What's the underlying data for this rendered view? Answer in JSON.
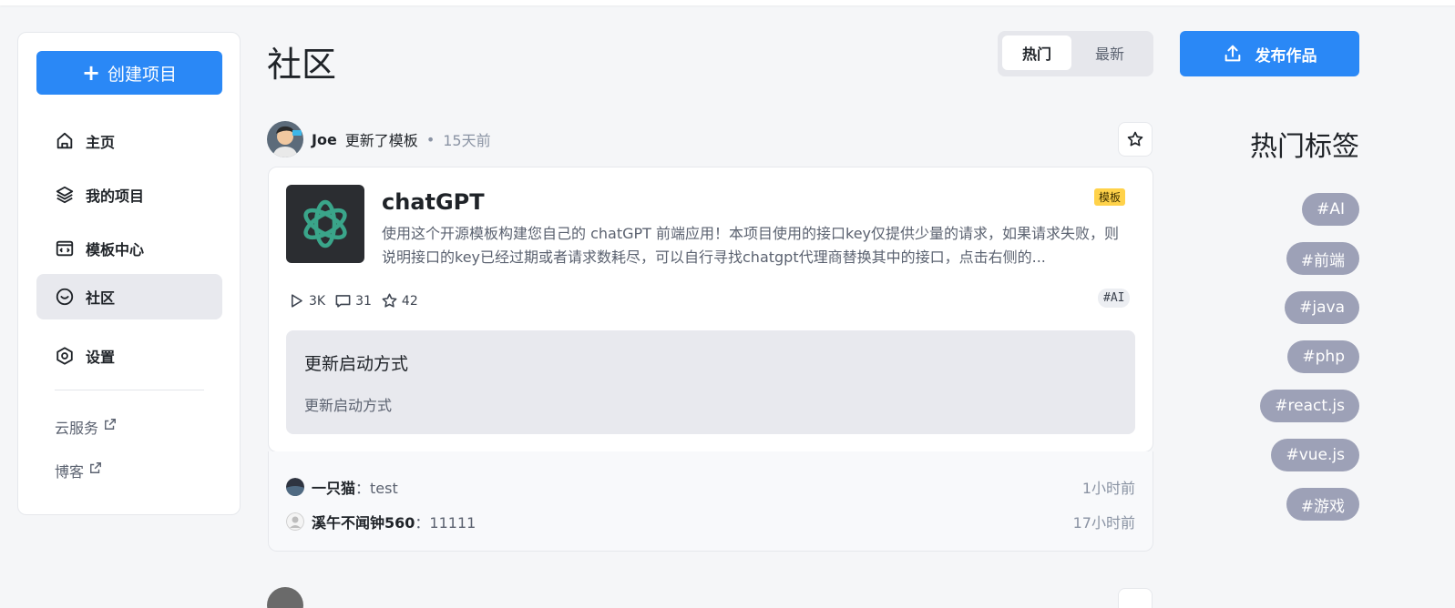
{
  "sidebar": {
    "create_label": "创建项目",
    "nav": [
      {
        "label": "主页"
      },
      {
        "label": "我的项目"
      },
      {
        "label": "模板中心"
      },
      {
        "label": "社区"
      },
      {
        "label": "设置"
      }
    ],
    "links": [
      {
        "label": "云服务"
      },
      {
        "label": "博客"
      }
    ]
  },
  "header": {
    "title": "社区",
    "tabs": [
      "热门",
      "最新"
    ],
    "active_tab": "热门",
    "publish_label": "发布作品"
  },
  "post": {
    "author": "Joe",
    "action": "更新了模板",
    "separator": "•",
    "time": "15天前",
    "project": {
      "title": "chatGPT",
      "badge": "模板",
      "description": "使用这个开源模板构建您自己的 chatGPT 前端应用！本项目使用的接口key仅提供少量的请求，如果请求失败，则说明接口的key已经过期或者请求数耗尽，可以自行寻找chatgpt代理商替换其中的接口，点击右侧的...",
      "plays": "3K",
      "comments": "31",
      "stars": "42",
      "tag": "#AI"
    },
    "update": {
      "title": "更新启动方式",
      "body": "更新启动方式"
    },
    "comment_list": [
      {
        "name": "一只猫",
        "sep": "：",
        "text": "test",
        "time": "1小时前"
      },
      {
        "name": "溪午不闻钟560",
        "sep": "：",
        "text": "11111",
        "time": "17小时前"
      }
    ]
  },
  "hot_tags": {
    "title": "热门标签",
    "items": [
      "#AI",
      "#前端",
      "#java",
      "#php",
      "#react.js",
      "#vue.js",
      "#游戏"
    ]
  },
  "colors": {
    "accent": "#2a88f6",
    "tag_bg": "#9da1b7",
    "badge": "#ffd24a"
  }
}
